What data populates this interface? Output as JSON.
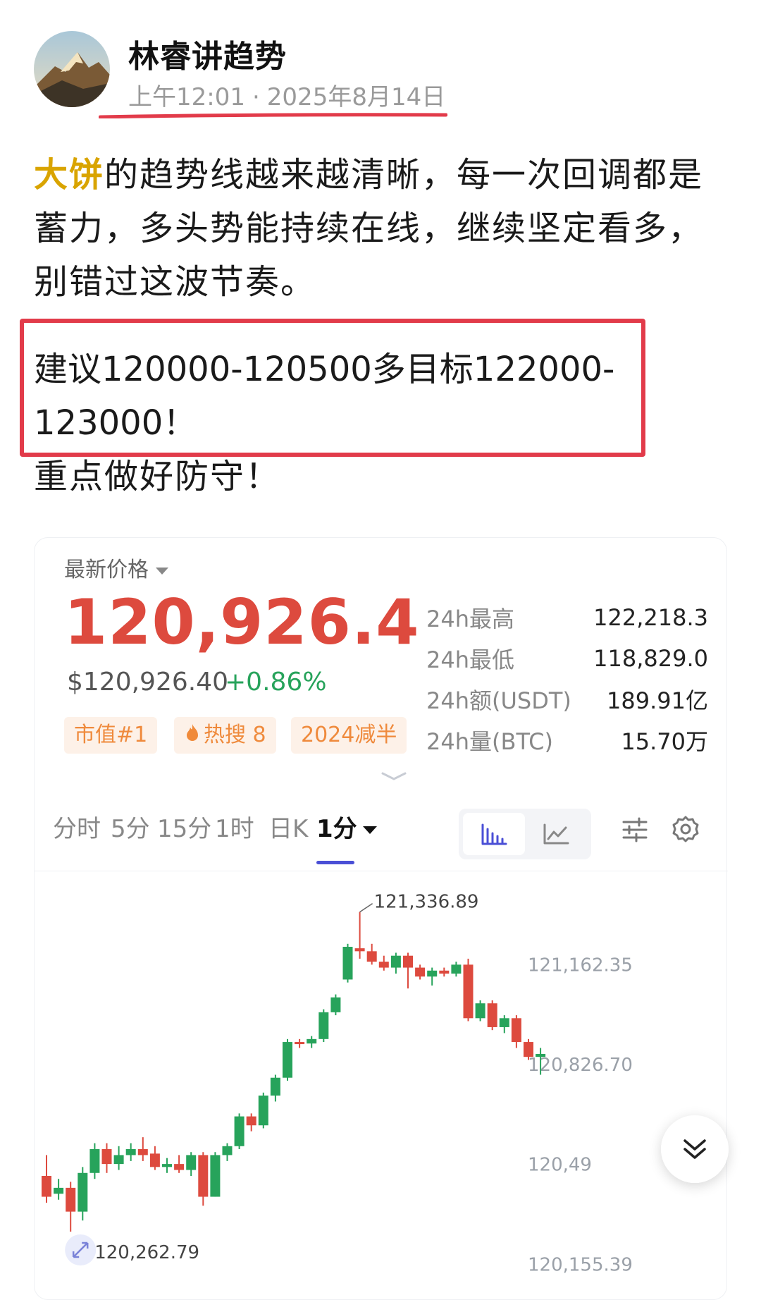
{
  "post": {
    "author": "林睿讲趋势",
    "time": "上午12:01",
    "date": "2025年8月14日",
    "keyword": "大饼",
    "body": "的趋势线越来越清晰，每一次回调都是蓄力，多头势能持续在线，继续坚定看多，别错过这波节奏。",
    "callout": "建议120000-120500多目标122000-123000！",
    "footer": "重点做好防守！"
  },
  "ticker": {
    "price_label": "最新价格",
    "price": "120,926.4",
    "usd_price": "$120,926.40",
    "change": "+0.86%",
    "tags": [
      "市值#1",
      "热搜 8",
      "2024减半"
    ],
    "stats": [
      {
        "label": "24h最高",
        "value": "122,218.3"
      },
      {
        "label": "24h最低",
        "value": "118,829.0"
      },
      {
        "label": "24h额(USDT)",
        "value": "189.91亿"
      },
      {
        "label": "24h量(BTC)",
        "value": "15.70万"
      }
    ]
  },
  "tabs": {
    "items": [
      "分时",
      "5分",
      "15分",
      "1时",
      "日K"
    ],
    "active": "1分"
  },
  "colors": {
    "up": "#27a35b",
    "down": "#dd4a3e",
    "accent": "#4a4fd6",
    "callout_border": "#e23b4a",
    "keyword": "#d9a400"
  },
  "chart_data": {
    "type": "candlestick",
    "price_labels": [
      "121,162.35",
      "120,826.70",
      "120,49",
      "120,155.39"
    ],
    "y_ticks": [
      121162.35,
      120826.7,
      120491.05,
      120155.39
    ],
    "high_label": "121,336.89",
    "low_label": "120,262.79",
    "candles": [
      {
        "o": 120450,
        "h": 120520,
        "c": 120380,
        "l": 120360
      },
      {
        "o": 120390,
        "h": 120440,
        "c": 120410,
        "l": 120370
      },
      {
        "o": 120410,
        "h": 120430,
        "c": 120330,
        "l": 120262.79
      },
      {
        "o": 120330,
        "h": 120480,
        "c": 120460,
        "l": 120300
      },
      {
        "o": 120460,
        "h": 120560,
        "c": 120540,
        "l": 120440
      },
      {
        "o": 120540,
        "h": 120560,
        "c": 120490,
        "l": 120460
      },
      {
        "o": 120490,
        "h": 120550,
        "c": 120520,
        "l": 120470
      },
      {
        "o": 120520,
        "h": 120560,
        "c": 120540,
        "l": 120500
      },
      {
        "o": 120540,
        "h": 120580,
        "c": 120520,
        "l": 120500
      },
      {
        "o": 120525,
        "h": 120550,
        "c": 120480,
        "l": 120470
      },
      {
        "o": 120480,
        "h": 120510,
        "c": 120490,
        "l": 120460
      },
      {
        "o": 120490,
        "h": 120520,
        "c": 120470,
        "l": 120460
      },
      {
        "o": 120470,
        "h": 120530,
        "c": 120520,
        "l": 120450
      },
      {
        "o": 120520,
        "h": 120530,
        "c": 120380,
        "l": 120350
      },
      {
        "o": 120380,
        "h": 120530,
        "c": 120520,
        "l": 120380
      },
      {
        "o": 120520,
        "h": 120560,
        "c": 120550,
        "l": 120500
      },
      {
        "o": 120550,
        "h": 120660,
        "c": 120650,
        "l": 120540
      },
      {
        "o": 120650,
        "h": 120660,
        "c": 120620,
        "l": 120600
      },
      {
        "o": 120620,
        "h": 120730,
        "c": 120720,
        "l": 120610
      },
      {
        "o": 120720,
        "h": 120790,
        "c": 120780,
        "l": 120700
      },
      {
        "o": 120780,
        "h": 120910,
        "c": 120900,
        "l": 120770
      },
      {
        "o": 120900,
        "h": 120910,
        "c": 120895,
        "l": 120880
      },
      {
        "o": 120895,
        "h": 120920,
        "c": 120910,
        "l": 120880
      },
      {
        "o": 120910,
        "h": 121010,
        "c": 121000,
        "l": 120900
      },
      {
        "o": 121000,
        "h": 121060,
        "c": 121050,
        "l": 120990
      },
      {
        "o": 121110,
        "h": 121230,
        "c": 121220,
        "l": 121100
      },
      {
        "o": 121215,
        "h": 121336.89,
        "c": 121205,
        "l": 121180
      },
      {
        "o": 121205,
        "h": 121230,
        "c": 121170,
        "l": 121160
      },
      {
        "o": 121170,
        "h": 121190,
        "c": 121150,
        "l": 121140
      },
      {
        "o": 121150,
        "h": 121200,
        "c": 121190,
        "l": 121130
      },
      {
        "o": 121190,
        "h": 121200,
        "c": 121150,
        "l": 121080
      },
      {
        "o": 121150,
        "h": 121160,
        "c": 121120,
        "l": 121110
      },
      {
        "o": 121120,
        "h": 121150,
        "c": 121140,
        "l": 121090
      },
      {
        "o": 121140,
        "h": 121150,
        "c": 121130,
        "l": 121120
      },
      {
        "o": 121130,
        "h": 121170,
        "c": 121160,
        "l": 121120
      },
      {
        "o": 121160,
        "h": 121180,
        "c": 120980,
        "l": 120970
      },
      {
        "o": 120980,
        "h": 121040,
        "c": 121030,
        "l": 120970
      },
      {
        "o": 121030,
        "h": 121040,
        "c": 120950,
        "l": 120940
      },
      {
        "o": 120950,
        "h": 120990,
        "c": 120980,
        "l": 120930
      },
      {
        "o": 120980,
        "h": 120990,
        "c": 120900,
        "l": 120880
      },
      {
        "o": 120900,
        "h": 120910,
        "c": 120850,
        "l": 120840
      },
      {
        "o": 120850,
        "h": 120880,
        "c": 120860,
        "l": 120790
      }
    ]
  }
}
